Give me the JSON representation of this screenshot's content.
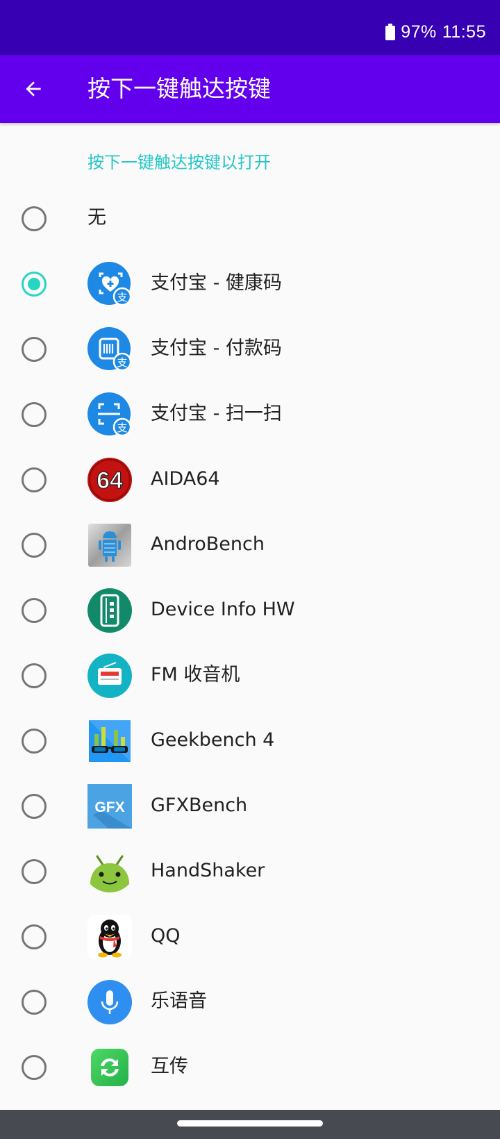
{
  "status_bar": {
    "battery_icon": "battery-icon",
    "battery": "97%",
    "time": "11:55"
  },
  "app_bar": {
    "back_icon": "arrow-back-icon",
    "title": "按下一键触达按键"
  },
  "section_header": "按下一键触达按键以打开",
  "options": [
    {
      "label": "无",
      "icon": null,
      "checked": false
    },
    {
      "label": "支付宝 - 健康码",
      "icon": "alipay-health-code-icon",
      "checked": true
    },
    {
      "label": "支付宝 - 付款码",
      "icon": "alipay-payment-code-icon",
      "checked": false
    },
    {
      "label": "支付宝 - 扫一扫",
      "icon": "alipay-scan-icon",
      "checked": false
    },
    {
      "label": "AIDA64",
      "icon": "aida64-icon",
      "checked": false
    },
    {
      "label": "AndroBench",
      "icon": "androbench-icon",
      "checked": false
    },
    {
      "label": "Device Info HW",
      "icon": "device-info-hw-icon",
      "checked": false
    },
    {
      "label": "FM 收音机",
      "icon": "fm-radio-icon",
      "checked": false
    },
    {
      "label": "Geekbench 4",
      "icon": "geekbench-icon",
      "checked": false
    },
    {
      "label": "GFXBench",
      "icon": "gfxbench-icon",
      "checked": false
    },
    {
      "label": "HandShaker",
      "icon": "handshaker-icon",
      "checked": false
    },
    {
      "label": "QQ",
      "icon": "qq-icon",
      "checked": false
    },
    {
      "label": "乐语音",
      "icon": "le-voice-icon",
      "checked": false
    },
    {
      "label": "互传",
      "icon": "hu-chuan-icon",
      "checked": false
    }
  ],
  "icon_texts": {
    "alipay_badge": "支",
    "aida64": "64",
    "gfxbench": "GFX"
  },
  "colors": {
    "status_bar": "#3700b3",
    "app_bar": "#6200ee",
    "accent": "#26d5c2",
    "alipay_blue": "#1e88e5"
  }
}
